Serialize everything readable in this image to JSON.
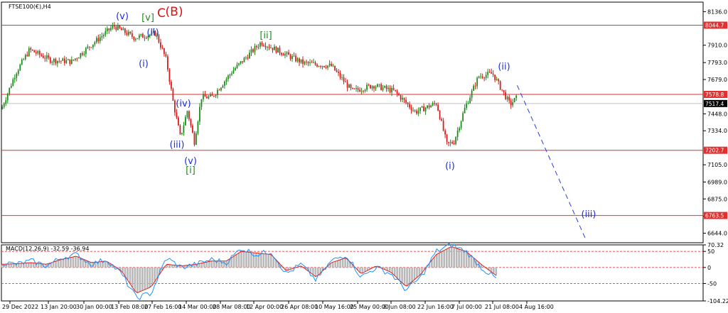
{
  "chart_data": [
    {
      "type": "candlestick",
      "title": "FTSE100(€),H4",
      "xlabel": "",
      "ylabel": "",
      "ylim": [
        6580,
        8200
      ],
      "x_ticks": [
        "29 Dec 2022",
        "13 Jan 20:00",
        "30 Jan 00:00",
        "13 Feb 08:00",
        "27 Feb 16:00",
        "14 Mar 00:00",
        "28 Mar 08:00",
        "12 Apr 00:00",
        "26 Apr 08:00",
        "10 May 16:00",
        "25 May 00:00",
        "8 Jun 08:00",
        "22 Jun 16:00",
        "7 Jul 00:00",
        "21 Jul 08:00",
        "4 Aug 16:00"
      ],
      "y_ticks": [
        8136.0,
        7910.0,
        7793.0,
        7679.0,
        7448.0,
        7334.0,
        7105.0,
        6989.0,
        6875.0,
        6758.0,
        6644.0
      ],
      "current_price": 7517.4,
      "horizontal_levels": [
        8044.7,
        7578.8,
        7202.7,
        6763.5
      ],
      "series": [
        {
          "x": [
            0,
            0.02,
            0.04,
            0.07,
            0.1,
            0.13,
            0.16,
            0.19,
            0.22,
            0.235,
            0.245,
            0.255,
            0.265,
            0.275,
            0.285,
            0.3,
            0.33,
            0.37,
            0.4,
            0.43,
            0.47,
            0.5,
            0.53,
            0.56,
            0.59,
            0.62,
            0.635,
            0.645,
            0.66,
            0.68,
            0.7,
            0.725,
            0.735
          ],
          "values": [
            7480,
            7720,
            7880,
            7810,
            7800,
            7920,
            8040,
            7960,
            7990,
            7810,
            7520,
            7290,
            7470,
            7260,
            7560,
            7560,
            7740,
            7930,
            7860,
            7790,
            7770,
            7600,
            7640,
            7600,
            7460,
            7520,
            7240,
            7260,
            7480,
            7700,
            7720,
            7510,
            7560
          ]
        }
      ],
      "wave_labels": [
        {
          "text": "(v)",
          "color": "#1f2fd6"
        },
        {
          "text": "[v]",
          "color": "#1f8a1f"
        },
        {
          "text": "C",
          "color": "#e01010"
        },
        {
          "text": "(B)",
          "color": "#e01010"
        },
        {
          "text": "(ii)",
          "color": "#1f2fd6"
        },
        {
          "text": "(i)",
          "color": "#1f2fd6"
        },
        {
          "text": "[ii]",
          "color": "#1f8a1f"
        },
        {
          "text": "(iv)",
          "color": "#1f2fd6"
        },
        {
          "text": "(iii)",
          "color": "#1f2fd6"
        },
        {
          "text": "(v)",
          "color": "#1f2fd6"
        },
        {
          "text": "[i]",
          "color": "#1f8a1f"
        },
        {
          "text": "(i)",
          "color": "#1f2fd6"
        },
        {
          "text": "(ii)",
          "color": "#1f2fd6"
        },
        {
          "text": "(iii)",
          "color": "#1f2fd6"
        }
      ],
      "projection": {
        "from_value": 7640,
        "to_value": 6600,
        "style": "dashed"
      }
    },
    {
      "type": "line",
      "title": "MACD(12,26,9) -32.59 -36.94",
      "ylim": [
        -104.22,
        70.32
      ],
      "y_ticks": [
        70.32,
        50,
        0,
        -50,
        -104.22
      ],
      "levels": [
        50,
        0,
        -50
      ],
      "series": [
        {
          "name": "MACD",
          "values": [
            15,
            10,
            20,
            5,
            30,
            40,
            10,
            25,
            -20,
            -95,
            -80,
            30,
            0,
            10,
            25,
            15,
            60,
            40,
            50,
            -20,
            10,
            -40,
            20,
            40,
            -30,
            0,
            -20,
            -70,
            -30,
            50,
            70,
            50,
            0,
            -35
          ]
        },
        {
          "name": "Signal",
          "values": [
            10,
            12,
            15,
            10,
            25,
            35,
            15,
            20,
            -10,
            -80,
            -60,
            10,
            5,
            10,
            20,
            20,
            50,
            45,
            40,
            -10,
            5,
            -30,
            15,
            30,
            -20,
            5,
            -15,
            -60,
            -20,
            40,
            65,
            50,
            10,
            -25
          ]
        }
      ]
    }
  ]
}
